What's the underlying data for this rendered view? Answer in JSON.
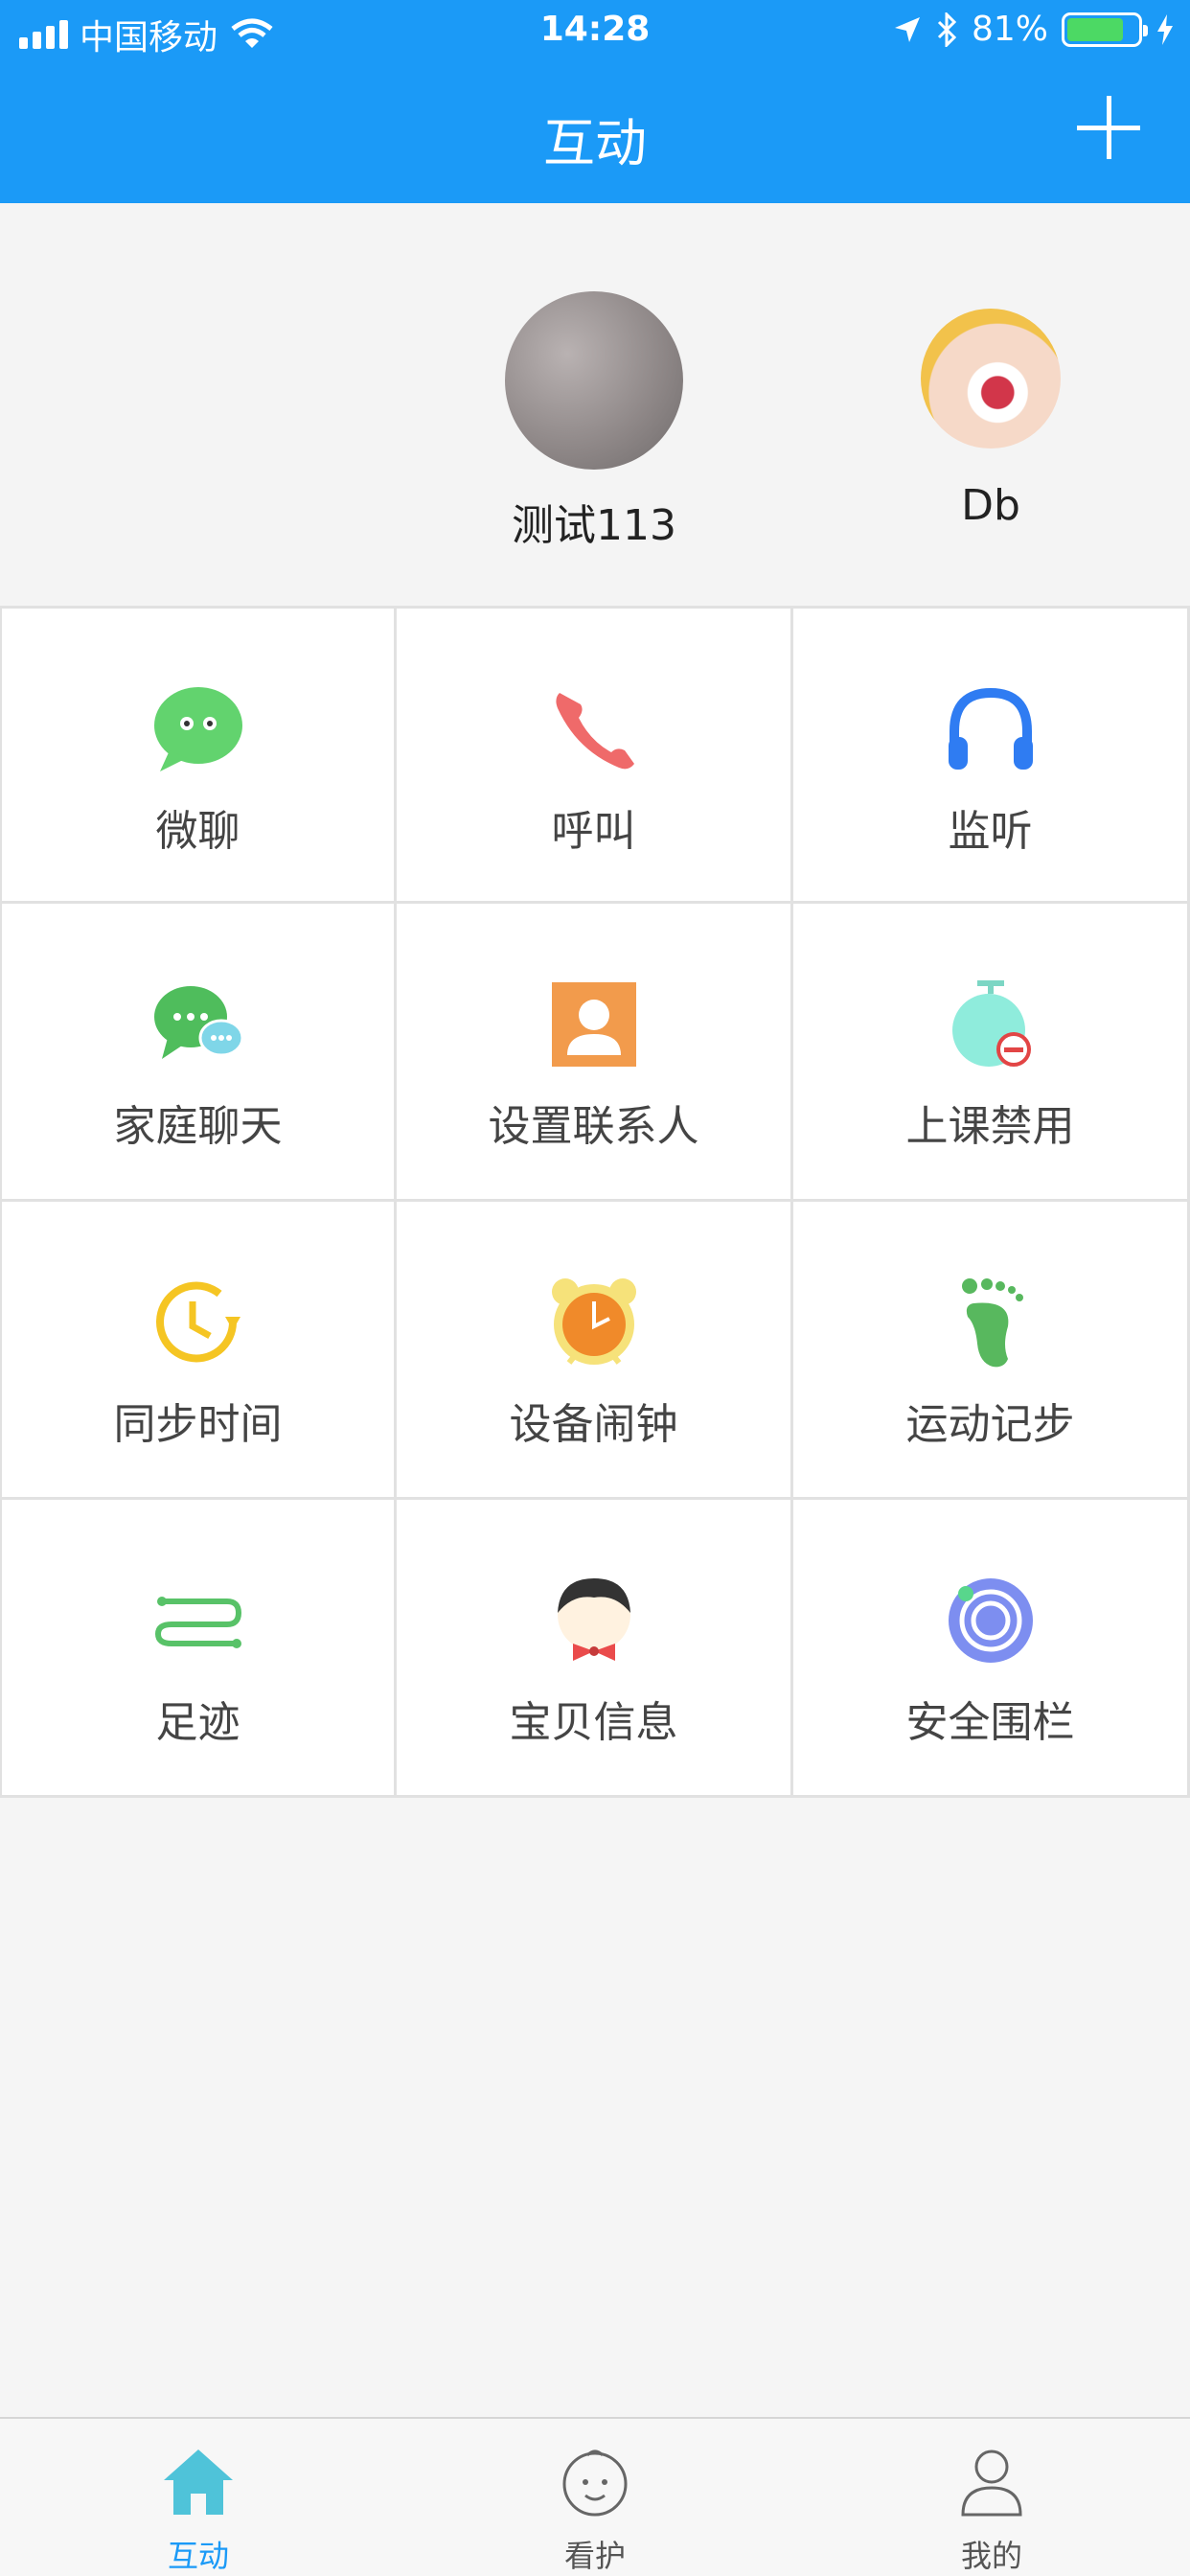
{
  "status_bar": {
    "carrier": "中国移动",
    "time": "14:28",
    "battery": "81%",
    "battery_level": 0.81
  },
  "header": {
    "title": "互动",
    "add_icon": "plus-icon"
  },
  "devices": [
    {
      "name": "测试113"
    },
    {
      "name": "Db"
    }
  ],
  "grid": [
    {
      "label": "微聊",
      "icon": "wechat-bubble-icon"
    },
    {
      "label": "呼叫",
      "icon": "phone-icon"
    },
    {
      "label": "监听",
      "icon": "headphones-icon"
    },
    {
      "label": "家庭聊天",
      "icon": "family-chat-icon"
    },
    {
      "label": "设置联系人",
      "icon": "contact-icon"
    },
    {
      "label": "上课禁用",
      "icon": "class-disable-icon"
    },
    {
      "label": "同步时间",
      "icon": "sync-time-icon"
    },
    {
      "label": "设备闹钟",
      "icon": "alarm-clock-icon"
    },
    {
      "label": "运动记步",
      "icon": "footprint-icon"
    },
    {
      "label": "足迹",
      "icon": "track-icon"
    },
    {
      "label": "宝贝信息",
      "icon": "baby-info-icon"
    },
    {
      "label": "安全围栏",
      "icon": "safety-fence-icon"
    }
  ],
  "tabs": [
    {
      "label": "互动",
      "active": true
    },
    {
      "label": "看护",
      "active": false
    },
    {
      "label": "我的",
      "active": false
    }
  ],
  "colors": {
    "primary": "#1b9af7",
    "tab_active": "#1b9af7"
  }
}
